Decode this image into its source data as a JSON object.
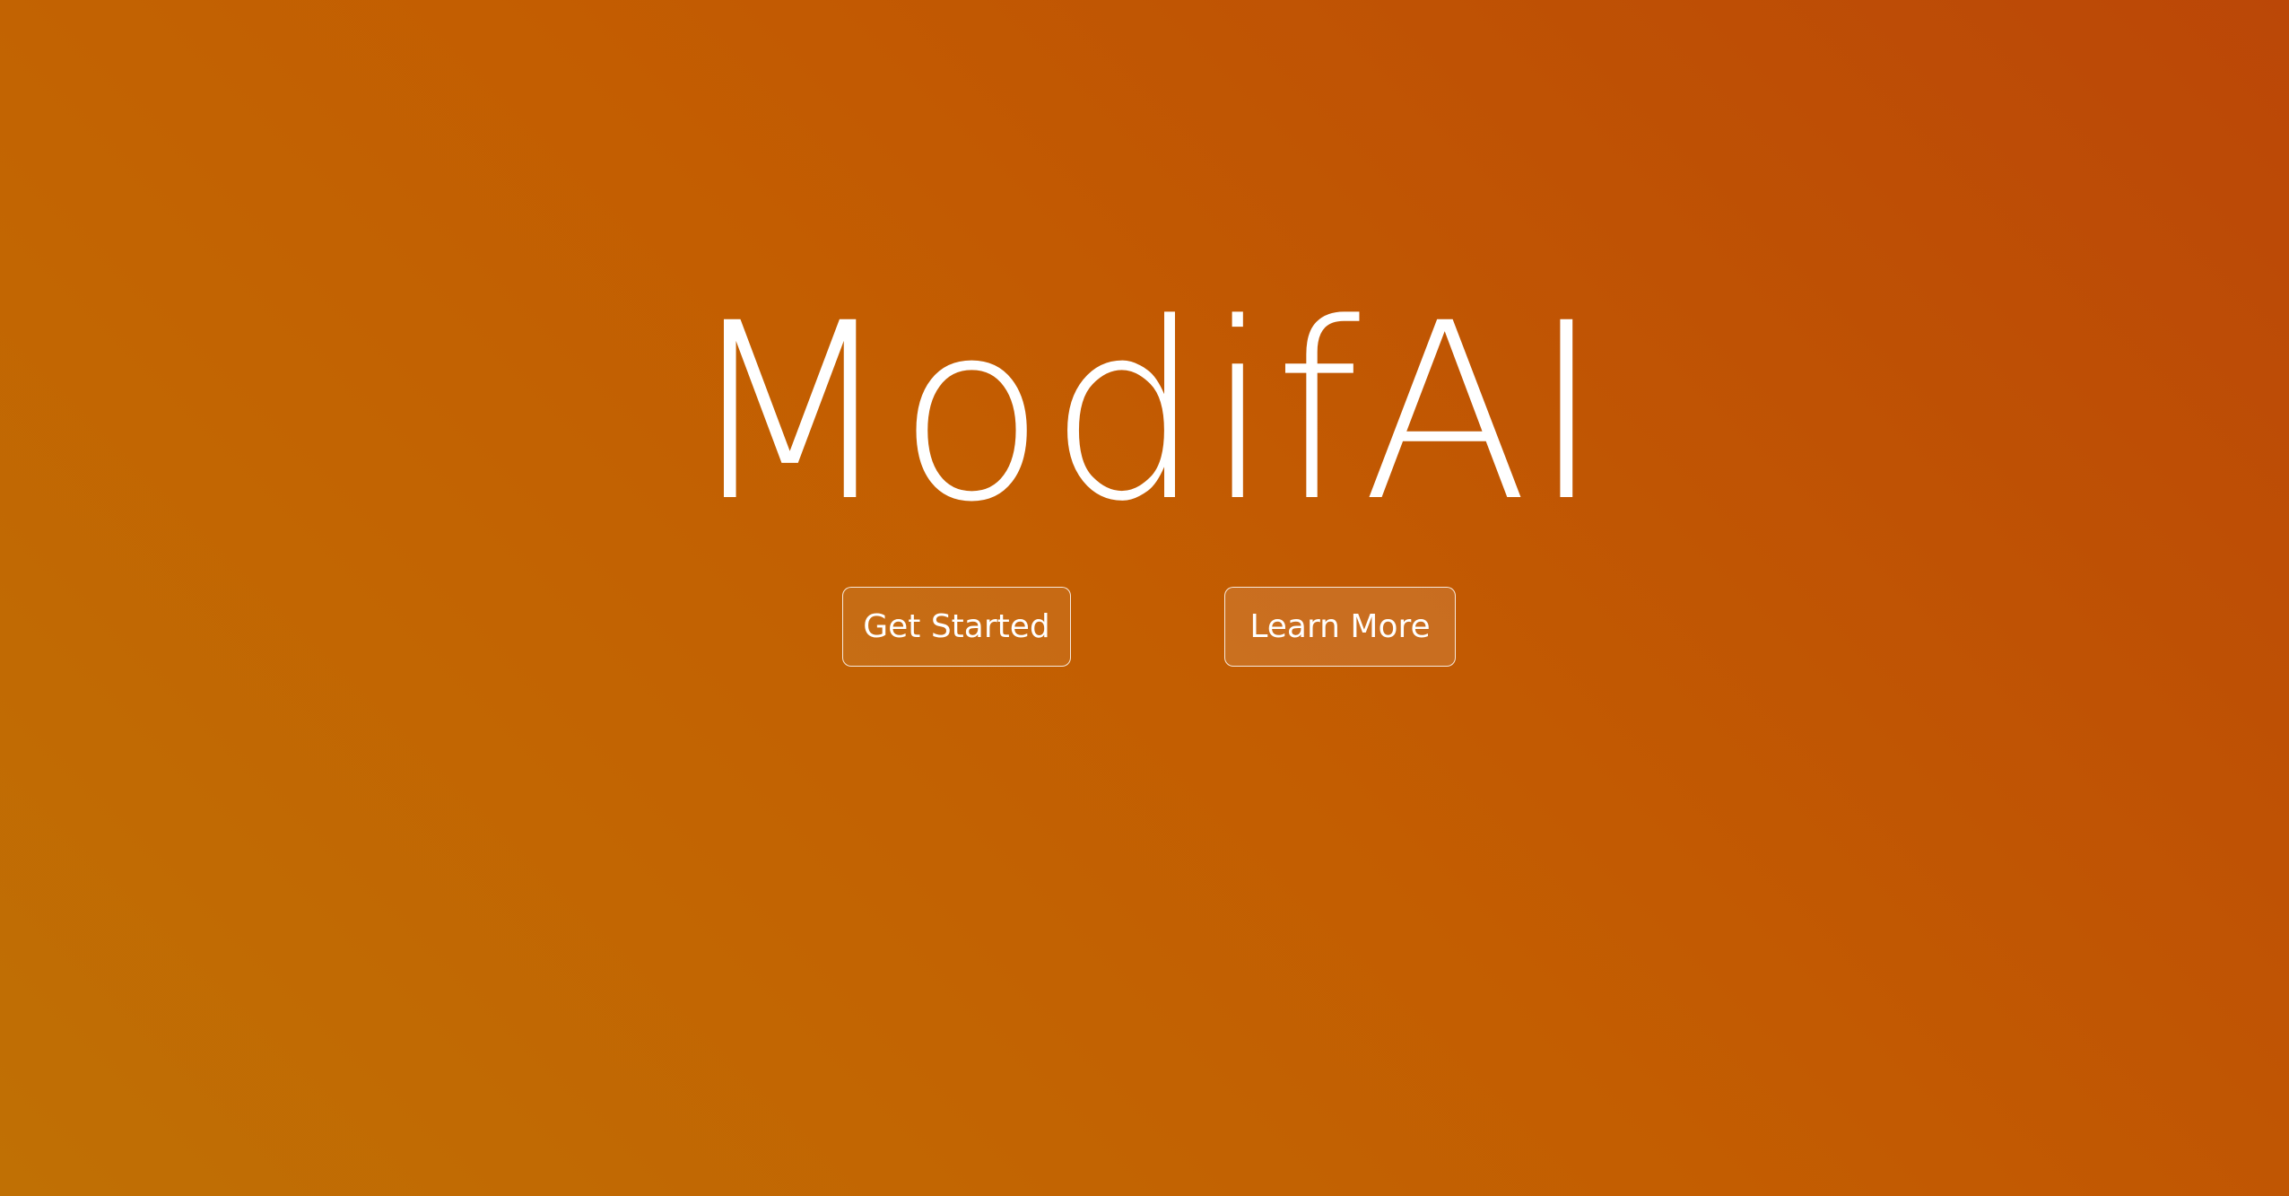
{
  "hero": {
    "title": "ModifAI",
    "background_colors": [
      "#c07004",
      "#c35d01",
      "#bb4707"
    ]
  },
  "buttons": {
    "get_started_label": "Get Started",
    "learn_more_label": "Learn More"
  }
}
